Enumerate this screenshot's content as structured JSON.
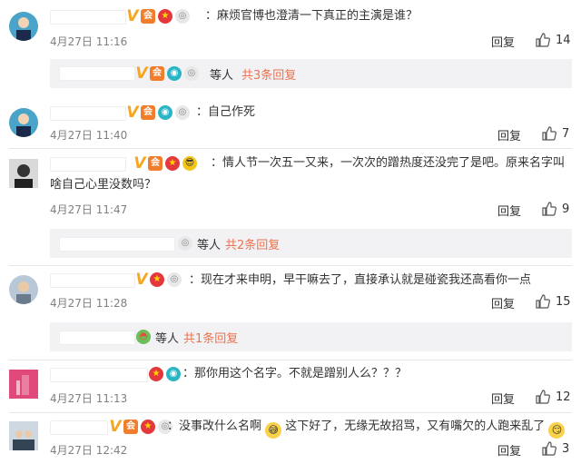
{
  "comments": [
    {
      "text": "：麻烦官博也澄清一下真正的主演是谁？",
      "time": "4月27日 11:16",
      "reply": "回复",
      "likes": "14"
    },
    {
      "text": "：自己作死",
      "time": "4月27日 11:40",
      "reply": "回复",
      "likes": "7"
    },
    {
      "text1": "：情人节一次五一又来，一次次的蹭热度还没完了是吧。原来名字叫",
      "text2": "啥自己心里没数吗？",
      "time": "4月27日 11:47",
      "reply": "回复",
      "likes": "9"
    },
    {
      "text": "：现在才来申明，早干嘛去了，直接承认就是碰瓷我还高看你一点",
      "time": "4月27日 11:28",
      "reply": "回复",
      "likes": "15"
    },
    {
      "text": "：那你用这个名字。不就是蹭别人么？？？",
      "time": "4月27日 11:13",
      "reply": "回复",
      "likes": "12"
    },
    {
      "text_a": "：没事改什么名啊",
      "text_b": "这下好了，无缘无故招骂，又有嘴欠的人跑来乱了",
      "time": "4月27日 12:42",
      "reply": "回复",
      "likes": "3"
    }
  ],
  "subthreads": [
    {
      "deng": "等人",
      "gong": "共3条回复"
    },
    {
      "deng": "等人",
      "gong": "共2条回复"
    },
    {
      "deng": "等人",
      "gong": "共1条回复"
    }
  ],
  "colors": {
    "link": "#eb7350",
    "time": "#808080",
    "sub_bg": "#f2f2f5"
  }
}
